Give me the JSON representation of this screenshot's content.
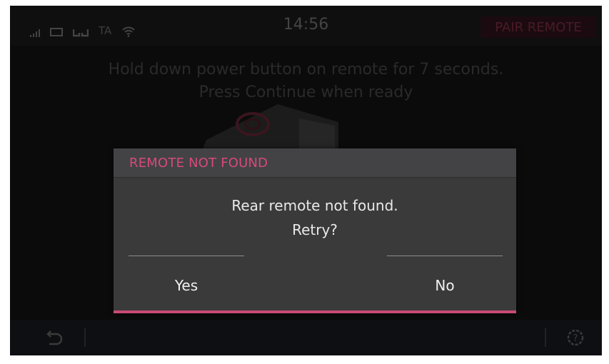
{
  "status_bar": {
    "ta_label": "TA",
    "time": "14:56",
    "mode_label": "PAIR REMOTE",
    "icons": [
      "signal-icon",
      "battery-icon",
      "phone-icon",
      "wifi-icon"
    ]
  },
  "background": {
    "instruction_line1": "Hold down power button on remote for 7 seconds.",
    "instruction_line2": "Press Continue when ready"
  },
  "dialog": {
    "title": "REMOTE NOT FOUND",
    "message_line1": "Rear remote not found.",
    "message_line2": "Retry?",
    "yes_label": "Yes",
    "no_label": "No"
  },
  "bottom_bar": {
    "icons": [
      "back-icon",
      "help-icon"
    ]
  },
  "colors": {
    "accent": "#c84a72",
    "title": "#d64a7a",
    "dialog_bg": "#3a3a3b"
  }
}
